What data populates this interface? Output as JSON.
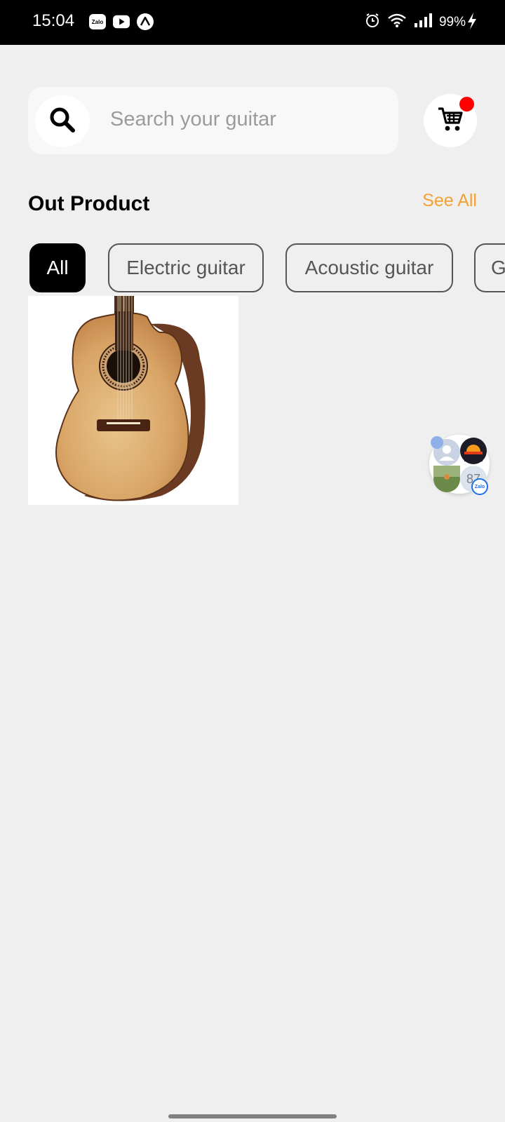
{
  "status_bar": {
    "time": "15:04",
    "app_icons": [
      "zalo-icon",
      "youtube-icon",
      "expo-icon"
    ],
    "indicator_icons": [
      "alarm-icon",
      "wifi-icon",
      "signal-icon"
    ],
    "battery": "99%",
    "charging_icon": "bolt-icon"
  },
  "search": {
    "placeholder": "Search your guitar",
    "icon": "search-icon"
  },
  "cart": {
    "icon": "cart-icon",
    "has_notification": true,
    "notification_color": "#ff0000"
  },
  "section": {
    "title": "Out Product",
    "see_all": "See All",
    "see_all_color": "#f5a033"
  },
  "categories": [
    {
      "label": "All",
      "active": true
    },
    {
      "label": "Electric guitar",
      "active": false
    },
    {
      "label": "Acoustic guitar",
      "active": false
    },
    {
      "label": "G",
      "active": false
    }
  ],
  "products": [
    {
      "image": "acoustic-guitar-image"
    }
  ],
  "chat_bubble": {
    "count": "87",
    "badge": "Zalo"
  }
}
